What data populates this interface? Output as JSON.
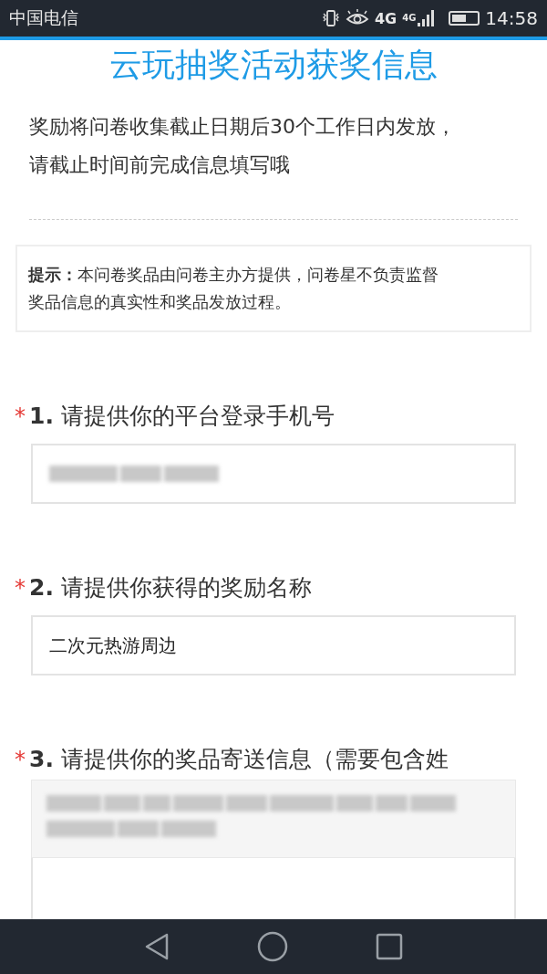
{
  "status_bar": {
    "carrier": "中国电信",
    "network_1": "4G",
    "network_2": "4G",
    "time": "14:58"
  },
  "title": "云玩抽奖活动获奖信息",
  "intro": [
    "奖励将问卷收集截止日期后30个工作日内发放，",
    "请截止时间前完成信息填写哦"
  ],
  "notice": [
    "**提示：**本问卷奖品由问卷主办方提供，问卷星不负责监督",
    "奖品信息的真实性和奖品发放过程。"
  ],
  "questions": [
    {
      "required_mark": "*",
      "number": "1.",
      "label": "请提供你的平台登录手机号",
      "answer": {
        "kind": "redacted"
      }
    },
    {
      "required_mark": "*",
      "number": "2.",
      "label": "请提供你获得的奖励名称",
      "answer": {
        "kind": "text",
        "value": "二次元热游周边"
      }
    },
    {
      "required_mark": "*",
      "number": "3.",
      "label": "请提供你的奖品寄送信息（需要包含姓",
      "answer": {
        "kind": "redacted_overlay"
      }
    }
  ]
}
